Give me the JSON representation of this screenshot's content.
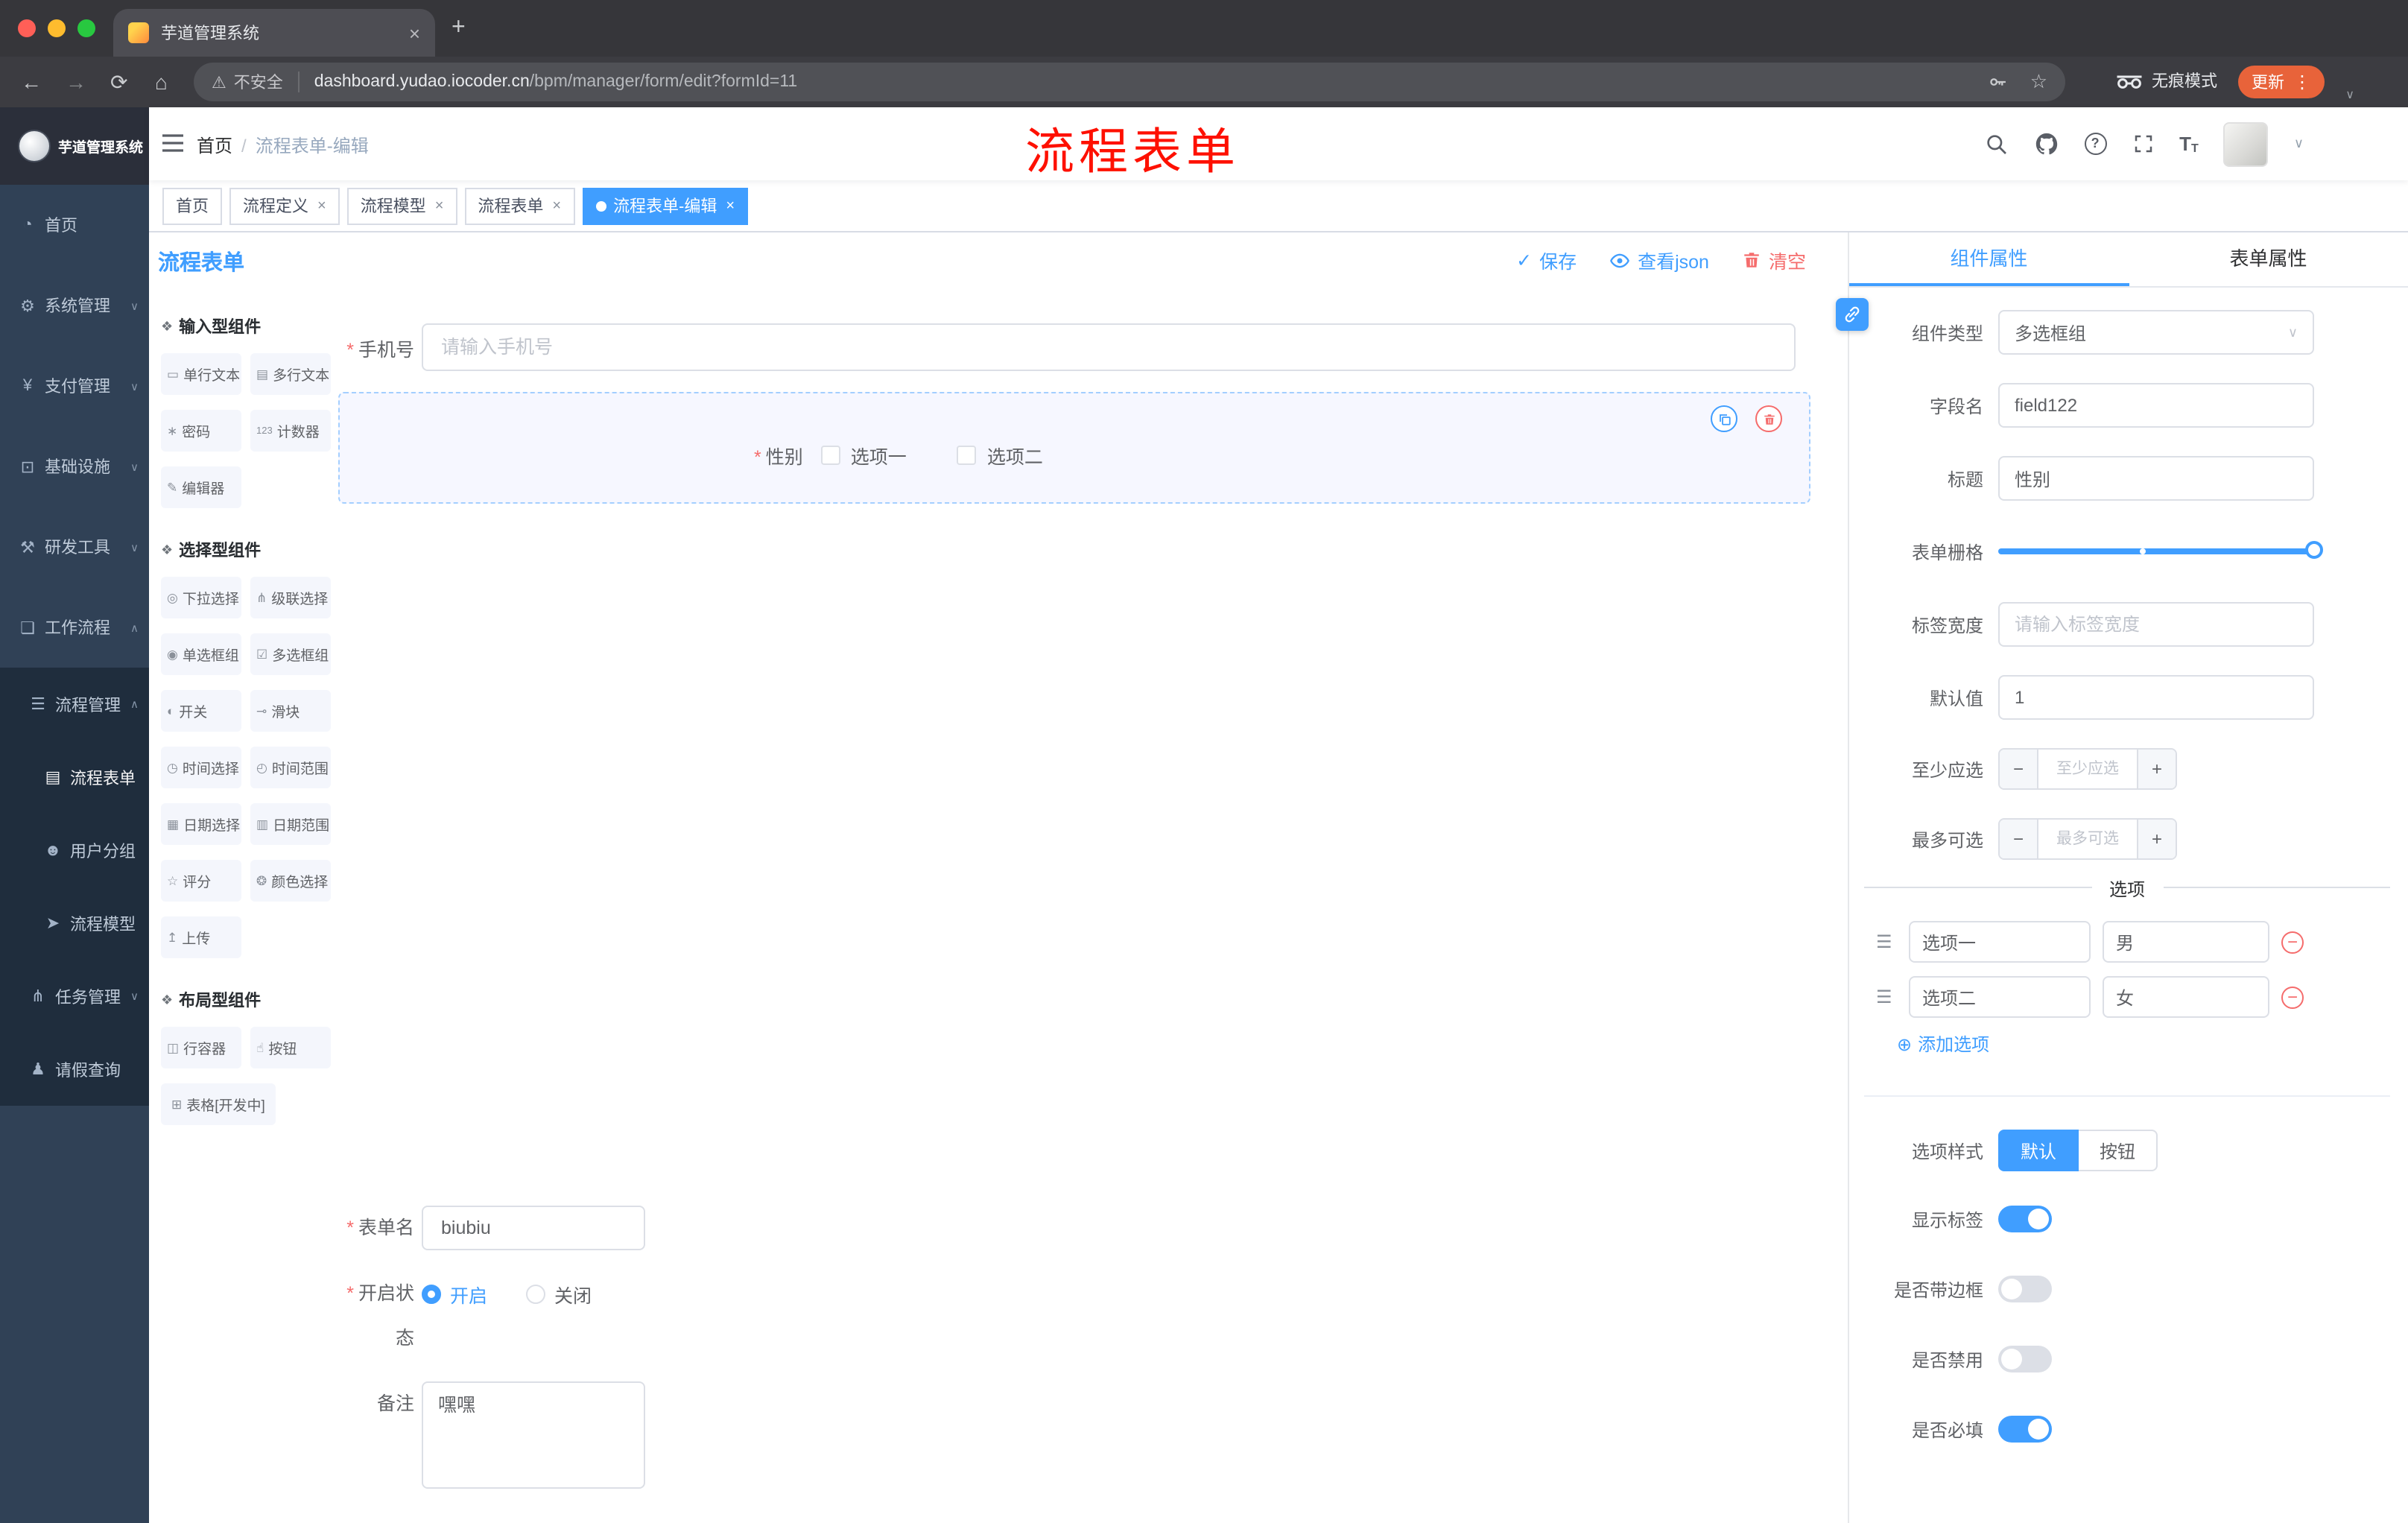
{
  "icons": {
    "close": "×",
    "plus": "+",
    "back": "←",
    "forward": "→",
    "reload": "⟳",
    "home": "⌂",
    "warning": "⚠",
    "star": "☆",
    "kebab": "⋮",
    "chev_down": "∨",
    "chev_up": "∧",
    "check": "✓",
    "sep": "/",
    "asterisk": "*",
    "minus": "−",
    "question": "?",
    "font_big": "T",
    "font_small": "T",
    "circle_plus": "⊕",
    "drag_handle": "☰",
    "section": "❖"
  },
  "browser": {
    "tab_title": "芋道管理系统",
    "security_label": "不安全",
    "url_domain": "dashboard.yudao.iocoder.cn",
    "url_path": "/bpm/manager/form/edit?formId=11",
    "incognito_label": "无痕模式",
    "update_label": "更新"
  },
  "sidebar": {
    "logo_title": "芋道管理系统",
    "items": [
      {
        "label": "首页",
        "icon": "◔"
      },
      {
        "label": "系统管理",
        "icon": "⚙"
      },
      {
        "label": "支付管理",
        "icon": "¥"
      },
      {
        "label": "基础设施",
        "icon": "⊡"
      },
      {
        "label": "研发工具",
        "icon": "⚒"
      },
      {
        "label": "工作流程",
        "icon": "❏"
      },
      {
        "label": "流程管理",
        "icon": "☰"
      },
      {
        "label": "流程表单",
        "icon": "▤"
      },
      {
        "label": "用户分组",
        "icon": "☻"
      },
      {
        "label": "流程模型",
        "icon": "➤"
      },
      {
        "label": "任务管理",
        "icon": "⋔"
      },
      {
        "label": "请假查询",
        "icon": "♟"
      }
    ]
  },
  "header": {
    "breadcrumb_root": "首页",
    "breadcrumb_current": "流程表单-编辑",
    "annotation": "流程表单"
  },
  "tags": [
    {
      "label": "首页"
    },
    {
      "label": "流程定义"
    },
    {
      "label": "流程模型"
    },
    {
      "label": "流程表单"
    },
    {
      "label": "流程表单-编辑"
    }
  ],
  "editor": {
    "title": "流程表单",
    "save": "保存",
    "view_json": "查看json",
    "clear": "清空",
    "sections": [
      {
        "title": "输入型组件",
        "items": [
          {
            "label": "单行文本",
            "icon": "▭"
          },
          {
            "label": "多行文本",
            "icon": "▤"
          },
          {
            "label": "密码",
            "icon": "∗"
          },
          {
            "label": "计数器",
            "icon": "123"
          },
          {
            "label": "编辑器",
            "icon": "✎"
          }
        ]
      },
      {
        "title": "选择型组件",
        "items": [
          {
            "label": "下拉选择",
            "icon": "◎"
          },
          {
            "label": "级联选择",
            "icon": "⋔"
          },
          {
            "label": "单选框组",
            "icon": "◉"
          },
          {
            "label": "多选框组",
            "icon": "☑"
          },
          {
            "label": "开关",
            "icon": "◐"
          },
          {
            "label": "滑块",
            "icon": "⊸"
          },
          {
            "label": "时间选择",
            "icon": "◷"
          },
          {
            "label": "时间范围",
            "icon": "◴"
          },
          {
            "label": "日期选择",
            "icon": "▦"
          },
          {
            "label": "日期范围",
            "icon": "▥"
          },
          {
            "label": "评分",
            "icon": "☆"
          },
          {
            "label": "颜色选择",
            "icon": "❂"
          },
          {
            "label": "上传",
            "icon": "↥"
          }
        ]
      },
      {
        "title": "布局型组件",
        "items": [
          {
            "label": "行容器",
            "icon": "◫"
          },
          {
            "label": "按钮",
            "icon": "☝"
          },
          {
            "label": "表格[开发中]",
            "icon": "⊞"
          }
        ]
      }
    ],
    "canvas": {
      "phone_label": "手机号",
      "phone_placeholder": "请输入手机号",
      "gender_label": "性别",
      "gender_options": [
        "选项一",
        "选项二"
      ]
    },
    "meta": {
      "name_label": "表单名",
      "name_value": "biubiu",
      "status_label": "开启状态",
      "status_on": "开启",
      "status_off": "关闭",
      "remark_label": "备注",
      "remark_value": "嘿嘿"
    }
  },
  "props": {
    "tab_component": "组件属性",
    "tab_form": "表单属性",
    "component_type_label": "组件类型",
    "component_type_value": "多选框组",
    "field_name_label": "字段名",
    "field_name_value": "field122",
    "title_label": "标题",
    "title_value": "性别",
    "grid_label": "表单栅格",
    "label_width_label": "标签宽度",
    "label_width_placeholder": "请输入标签宽度",
    "default_label": "默认值",
    "default_value": "1",
    "min_label": "至少应选",
    "min_placeholder": "至少应选",
    "max_label": "最多可选",
    "max_placeholder": "最多可选",
    "options_title": "选项",
    "options": [
      {
        "label": "选项一",
        "value": "男"
      },
      {
        "label": "选项二",
        "value": "女"
      }
    ],
    "add_option": "添加选项",
    "style_label": "选项样式",
    "style_default": "默认",
    "style_button": "按钮",
    "show_label": "显示标签",
    "border_label": "是否带边框",
    "disabled_label": "是否禁用",
    "required_label": "是否必填"
  },
  "colors": {
    "primary": "#409eff",
    "danger": "#f56c6c",
    "annotation": "#fe1000",
    "sidebar": "#304156"
  }
}
